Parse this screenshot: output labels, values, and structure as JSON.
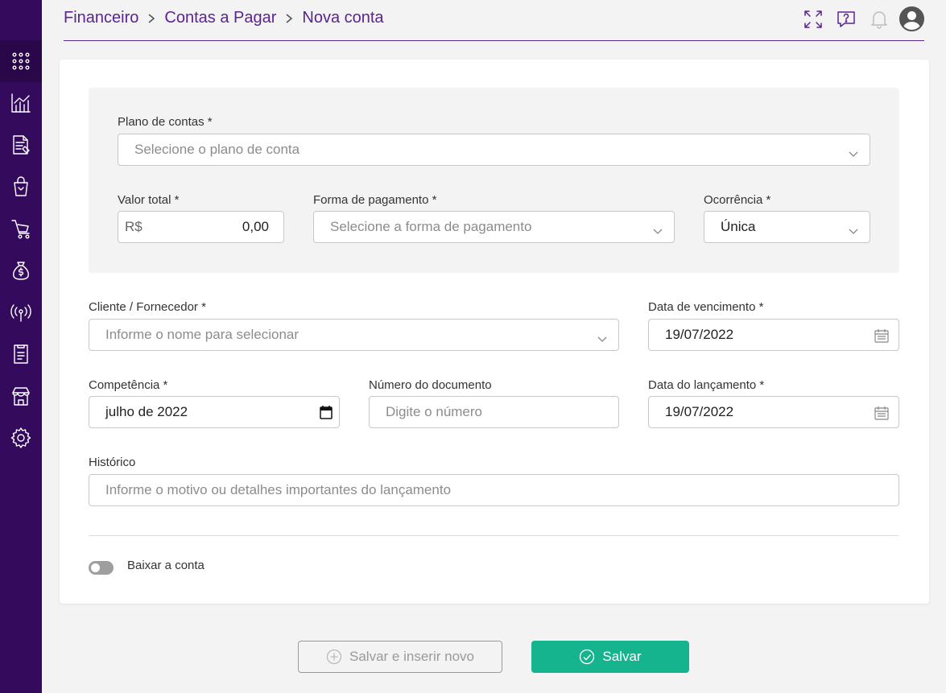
{
  "breadcrumb": [
    "Financeiro",
    "Contas a Pagar",
    "Nova conta"
  ],
  "top_icons": [
    "fullscreen-icon",
    "help-chat-icon",
    "bell-icon",
    "user-avatar-icon"
  ],
  "sidebar": [
    "apps-grid-icon",
    "chart-icon",
    "document-edit-icon",
    "shopping-bag-icon",
    "cart-icon",
    "money-bag-icon",
    "broadcast-icon",
    "report-icon",
    "store-icon",
    "settings-icon"
  ],
  "form": {
    "plano_label": "Plano de contas *",
    "plano_placeholder": "Selecione o plano de conta",
    "valor_label": "Valor total *",
    "valor_prefix": "R$",
    "valor_value": "0,00",
    "forma_label": "Forma de pagamento *",
    "forma_placeholder": "Selecione a forma de pagamento",
    "ocorrencia_label": "Ocorrência *",
    "ocorrencia_value": "Única",
    "cliente_label": "Cliente / Fornecedor *",
    "cliente_placeholder": "Informe o nome para selecionar",
    "vencimento_label": "Data de vencimento *",
    "vencimento_value": "19/07/2022",
    "competencia_label": "Competência *",
    "competencia_value": "julho de 2022",
    "numero_label": "Número do documento",
    "numero_placeholder": "Digite o número",
    "lancamento_label": "Data do lançamento *",
    "lancamento_value": "19/07/2022",
    "historico_label": "Histórico",
    "historico_placeholder": "Informe o motivo ou detalhes importantes do lançamento",
    "baixar_label": "Baixar a conta",
    "baixar_on": false
  },
  "buttons": {
    "save_new": "Salvar e inserir novo",
    "save": "Salvar"
  },
  "colors": {
    "sidebar": "#340a5c",
    "accent": "#5b2490",
    "primary_button": "#15b48e"
  }
}
